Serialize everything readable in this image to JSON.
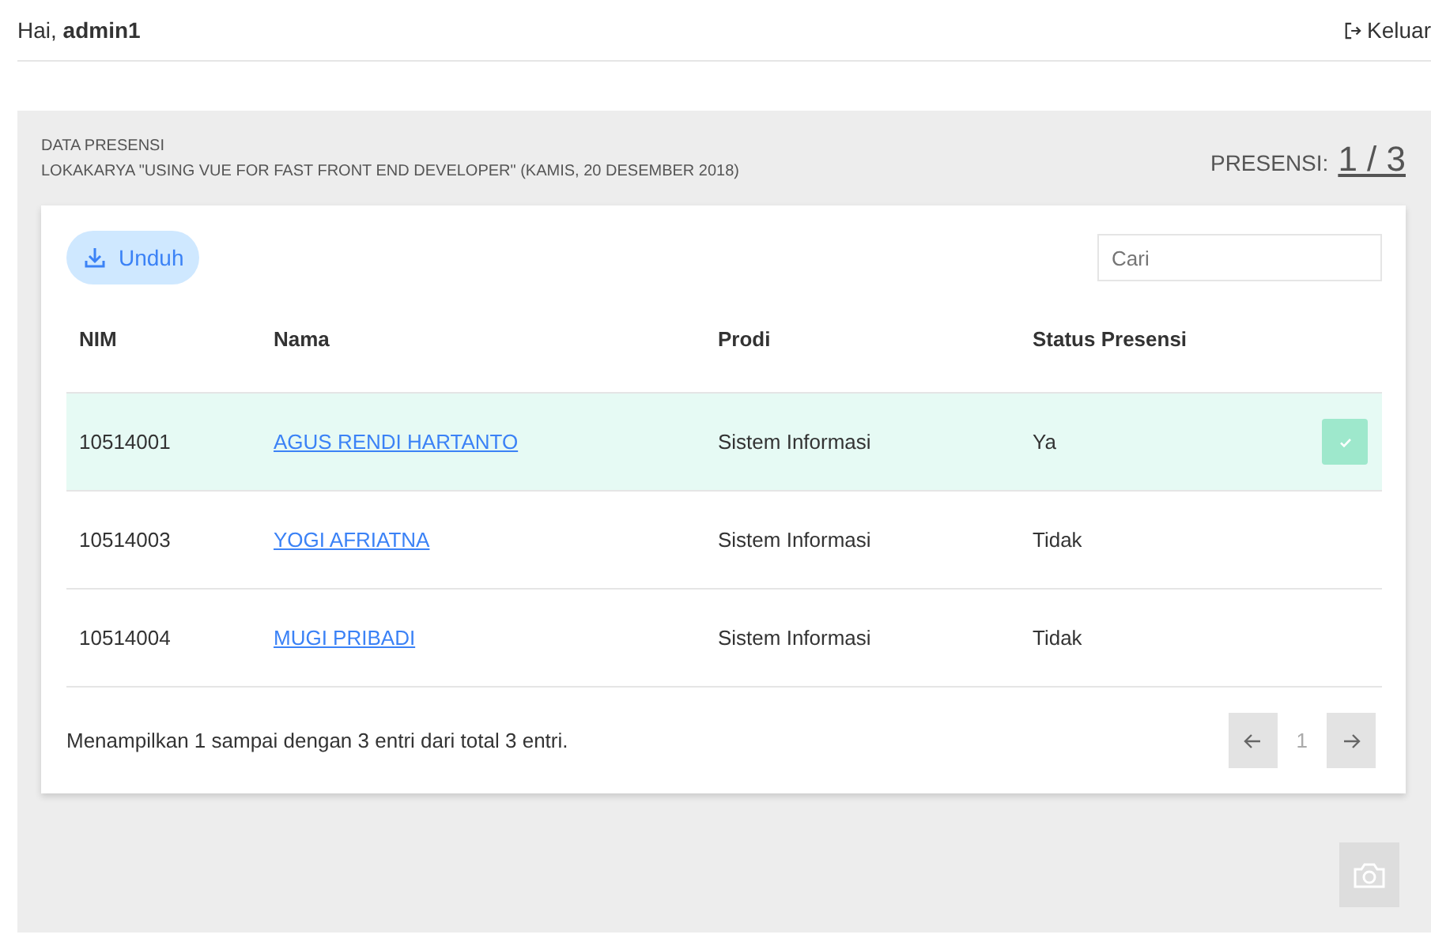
{
  "header": {
    "greeting": "Hai, **admin1**",
    "logout": "Keluar"
  },
  "panel": {
    "title": "DATA PRESENSI",
    "subtitle": "LOKAKARYA \"USING VUE FOR FAST FRONT END DEVELOPER\" (KAMIS, 20 DESEMBER 2018)",
    "count_label": "PRESENSI:",
    "count": "1 / 3"
  },
  "toolbar": {
    "download": "Unduh",
    "search": {
      "placeholder": "Cari"
    }
  },
  "table": {
    "columns": [
      "NIM",
      "Nama",
      "Prodi",
      "Status Presensi"
    ],
    "rows": [
      {
        "nim": "10514001",
        "name": "AGUS RENDI HARTANTO",
        "prodi": "Sistem Informasi",
        "status": "Ya",
        "checked": true
      },
      {
        "nim": "10514003",
        "name": "YOGI AFRIATNA",
        "prodi": "Sistem Informasi",
        "status": "Tidak",
        "checked": false
      },
      {
        "nim": "10514004",
        "name": "MUGI PRIBADI",
        "prodi": "Sistem Informasi",
        "status": "Tidak",
        "checked": false
      }
    ]
  },
  "footer": {
    "info": "Menampilkan 1 sampai dengan 3 entri dari total 3 entri.",
    "page": "1"
  }
}
